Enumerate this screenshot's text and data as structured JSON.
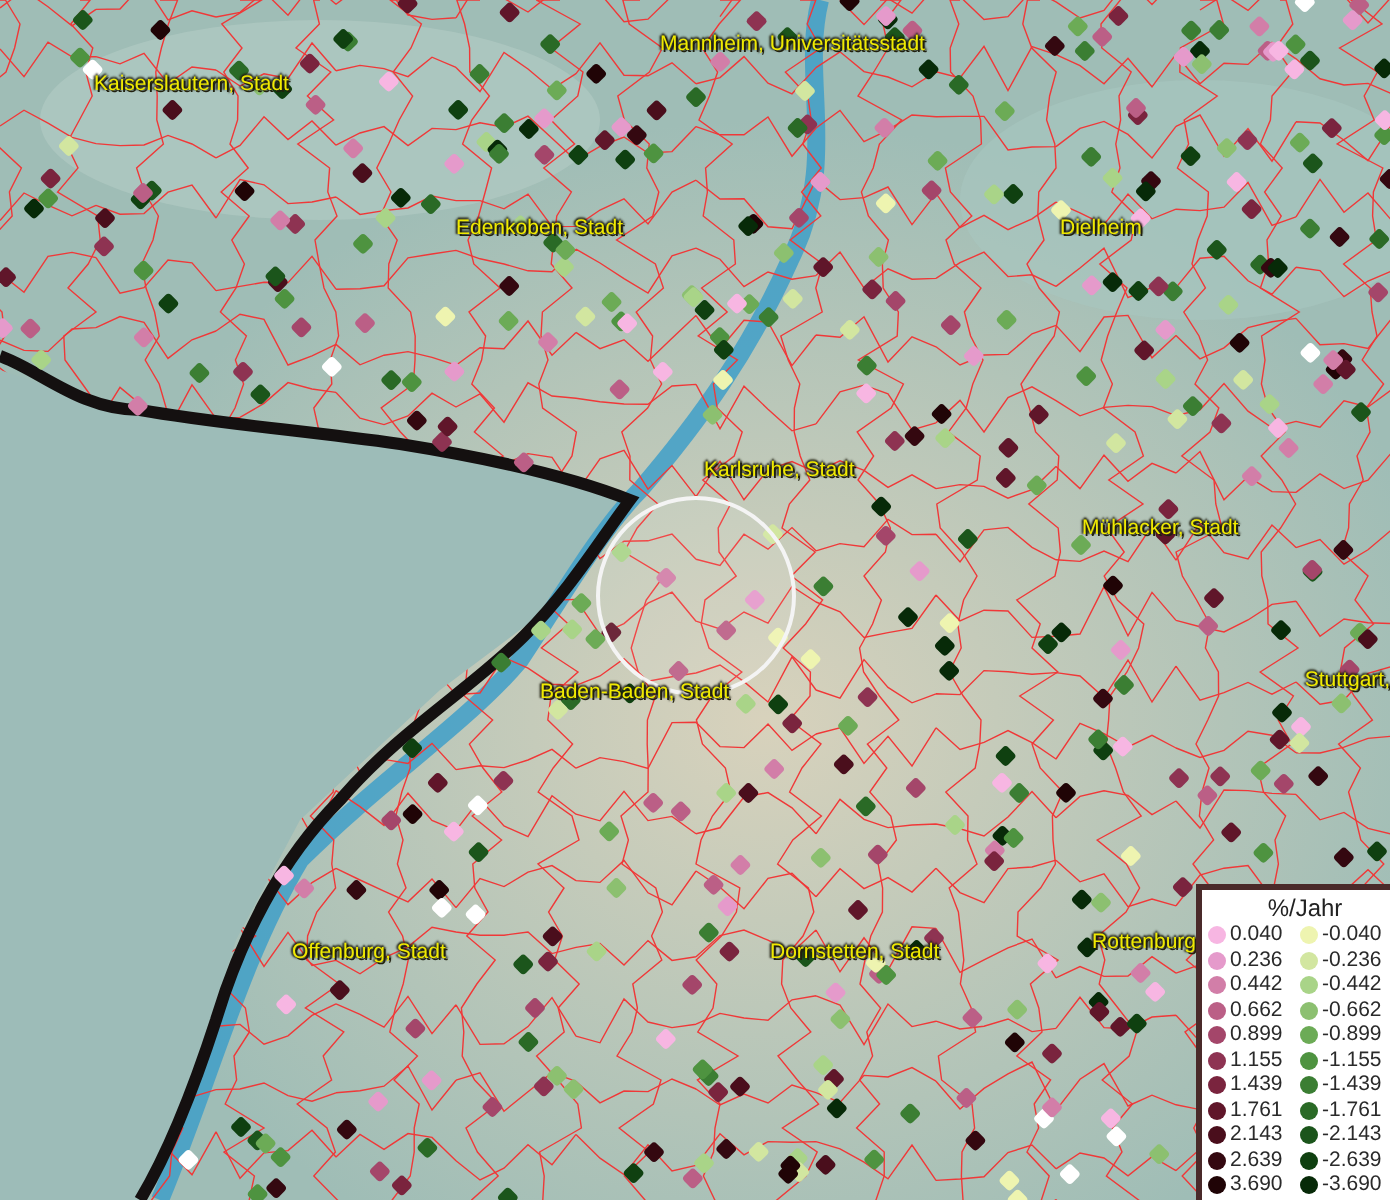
{
  "map": {
    "places": [
      "Kaiserslautern, Stadt",
      "Mannheim, Universitätsstadt",
      "Edenkoben, Stadt",
      "Dielheim",
      "Karlsruhe, Stadt",
      "Mühlacker, Stadt",
      "Stuttgart,",
      "Baden-Baden, Stadt",
      "Offenburg, Stadt",
      "Dornstetten, Stadt",
      "Rottenburg"
    ]
  },
  "legend": {
    "title": "%/Jahr",
    "rows": [
      [
        {
          "label": "0.040",
          "color": "#f7b6e2"
        },
        {
          "label": "-0.040",
          "color": "#eef4b0"
        }
      ],
      [
        {
          "label": "0.236",
          "color": "#e59acb"
        },
        {
          "label": "-0.236",
          "color": "#d2e6a0"
        }
      ],
      [
        {
          "label": "0.442",
          "color": "#d27ea8"
        },
        {
          "label": "-0.442",
          "color": "#a9d488"
        }
      ],
      [
        {
          "label": "0.662",
          "color": "#bb5f86"
        },
        {
          "label": "-0.662",
          "color": "#8cc070"
        }
      ],
      [
        {
          "label": "0.899",
          "color": "#a4466a"
        },
        {
          "label": "-0.899",
          "color": "#6cab56"
        }
      ],
      [
        {
          "label": "1.155",
          "color": "#8e3352"
        },
        {
          "label": "-1.155",
          "color": "#4e9340"
        }
      ],
      [
        {
          "label": "1.439",
          "color": "#7a243e"
        },
        {
          "label": "-1.439",
          "color": "#3b7e33"
        }
      ],
      [
        {
          "label": "1.761",
          "color": "#60162a"
        },
        {
          "label": "-1.761",
          "color": "#2a6a26"
        }
      ],
      [
        {
          "label": "2.143",
          "color": "#4a0e1c"
        },
        {
          "label": "-2.143",
          "color": "#1b551b"
        }
      ],
      [
        {
          "label": "2.639",
          "color": "#340810"
        },
        {
          "label": "-2.639",
          "color": "#0f4010"
        }
      ],
      [
        {
          "label": "3.690",
          "color": "#200406"
        },
        {
          "label": "-3.690",
          "color": "#072a08"
        }
      ]
    ]
  }
}
